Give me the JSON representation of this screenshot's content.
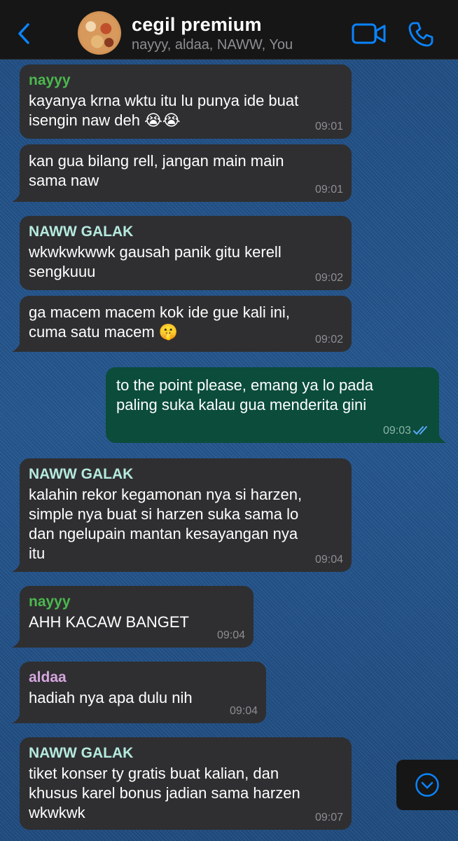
{
  "header": {
    "title": "cegil premium",
    "members": "nayyy, aldaa, NAWW, You",
    "back_icon": "chevron-left-icon",
    "video_icon": "video-camera-icon",
    "call_icon": "phone-icon",
    "accent": "#0a84ff"
  },
  "colors": {
    "incoming_bubble": "#2f2f31",
    "outgoing_bubble": "#0b4c3b",
    "sender_nayyy": "#4cb84e",
    "sender_naww": "#b5eadd",
    "sender_aldaa": "#d5a6e0"
  },
  "messages": [
    {
      "sender": "nayyy",
      "text1": "kayanya krna wktu itu lu punya ide buat",
      "text2": "isengin naw deh 😭😭",
      "time": "09:01"
    },
    {
      "text1": "kan gua bilang rell, jangan main main",
      "text2": "sama naw",
      "time": "09:01"
    },
    {
      "sender": "NAWW GALAK",
      "text1": "wkwkwkwwk gausah panik gitu kerell",
      "text2": "sengkuuu",
      "time": "09:02"
    },
    {
      "text1": "ga macem macem kok ide gue kali ini,",
      "text2": "cuma satu macem 🤫",
      "time": "09:02"
    },
    {
      "text1": "to the point please, emang ya lo pada",
      "text2": "paling suka kalau gua menderita gini",
      "time": "09:03",
      "status": "read"
    },
    {
      "sender": "NAWW GALAK",
      "text1": "kalahin rekor kegamonan nya si harzen,",
      "text2": "simple nya buat si harzen suka sama lo",
      "text3": "dan ngelupain mantan kesayangan nya",
      "text4": "itu",
      "time": "09:04"
    },
    {
      "sender": "nayyy",
      "text1": "AHH KACAW BANGET",
      "time": "09:04"
    },
    {
      "sender": "aldaa",
      "text1": "hadiah nya apa dulu nih",
      "time": "09:04"
    },
    {
      "sender": "NAWW GALAK",
      "text1": "tiket konser ty gratis buat kalian, dan",
      "text2": "khusus karel bonus jadian sama harzen",
      "text3": "wkwkwk",
      "time": "09:07"
    }
  ],
  "scroll_button": {
    "icon": "chevron-down-circle-icon"
  }
}
